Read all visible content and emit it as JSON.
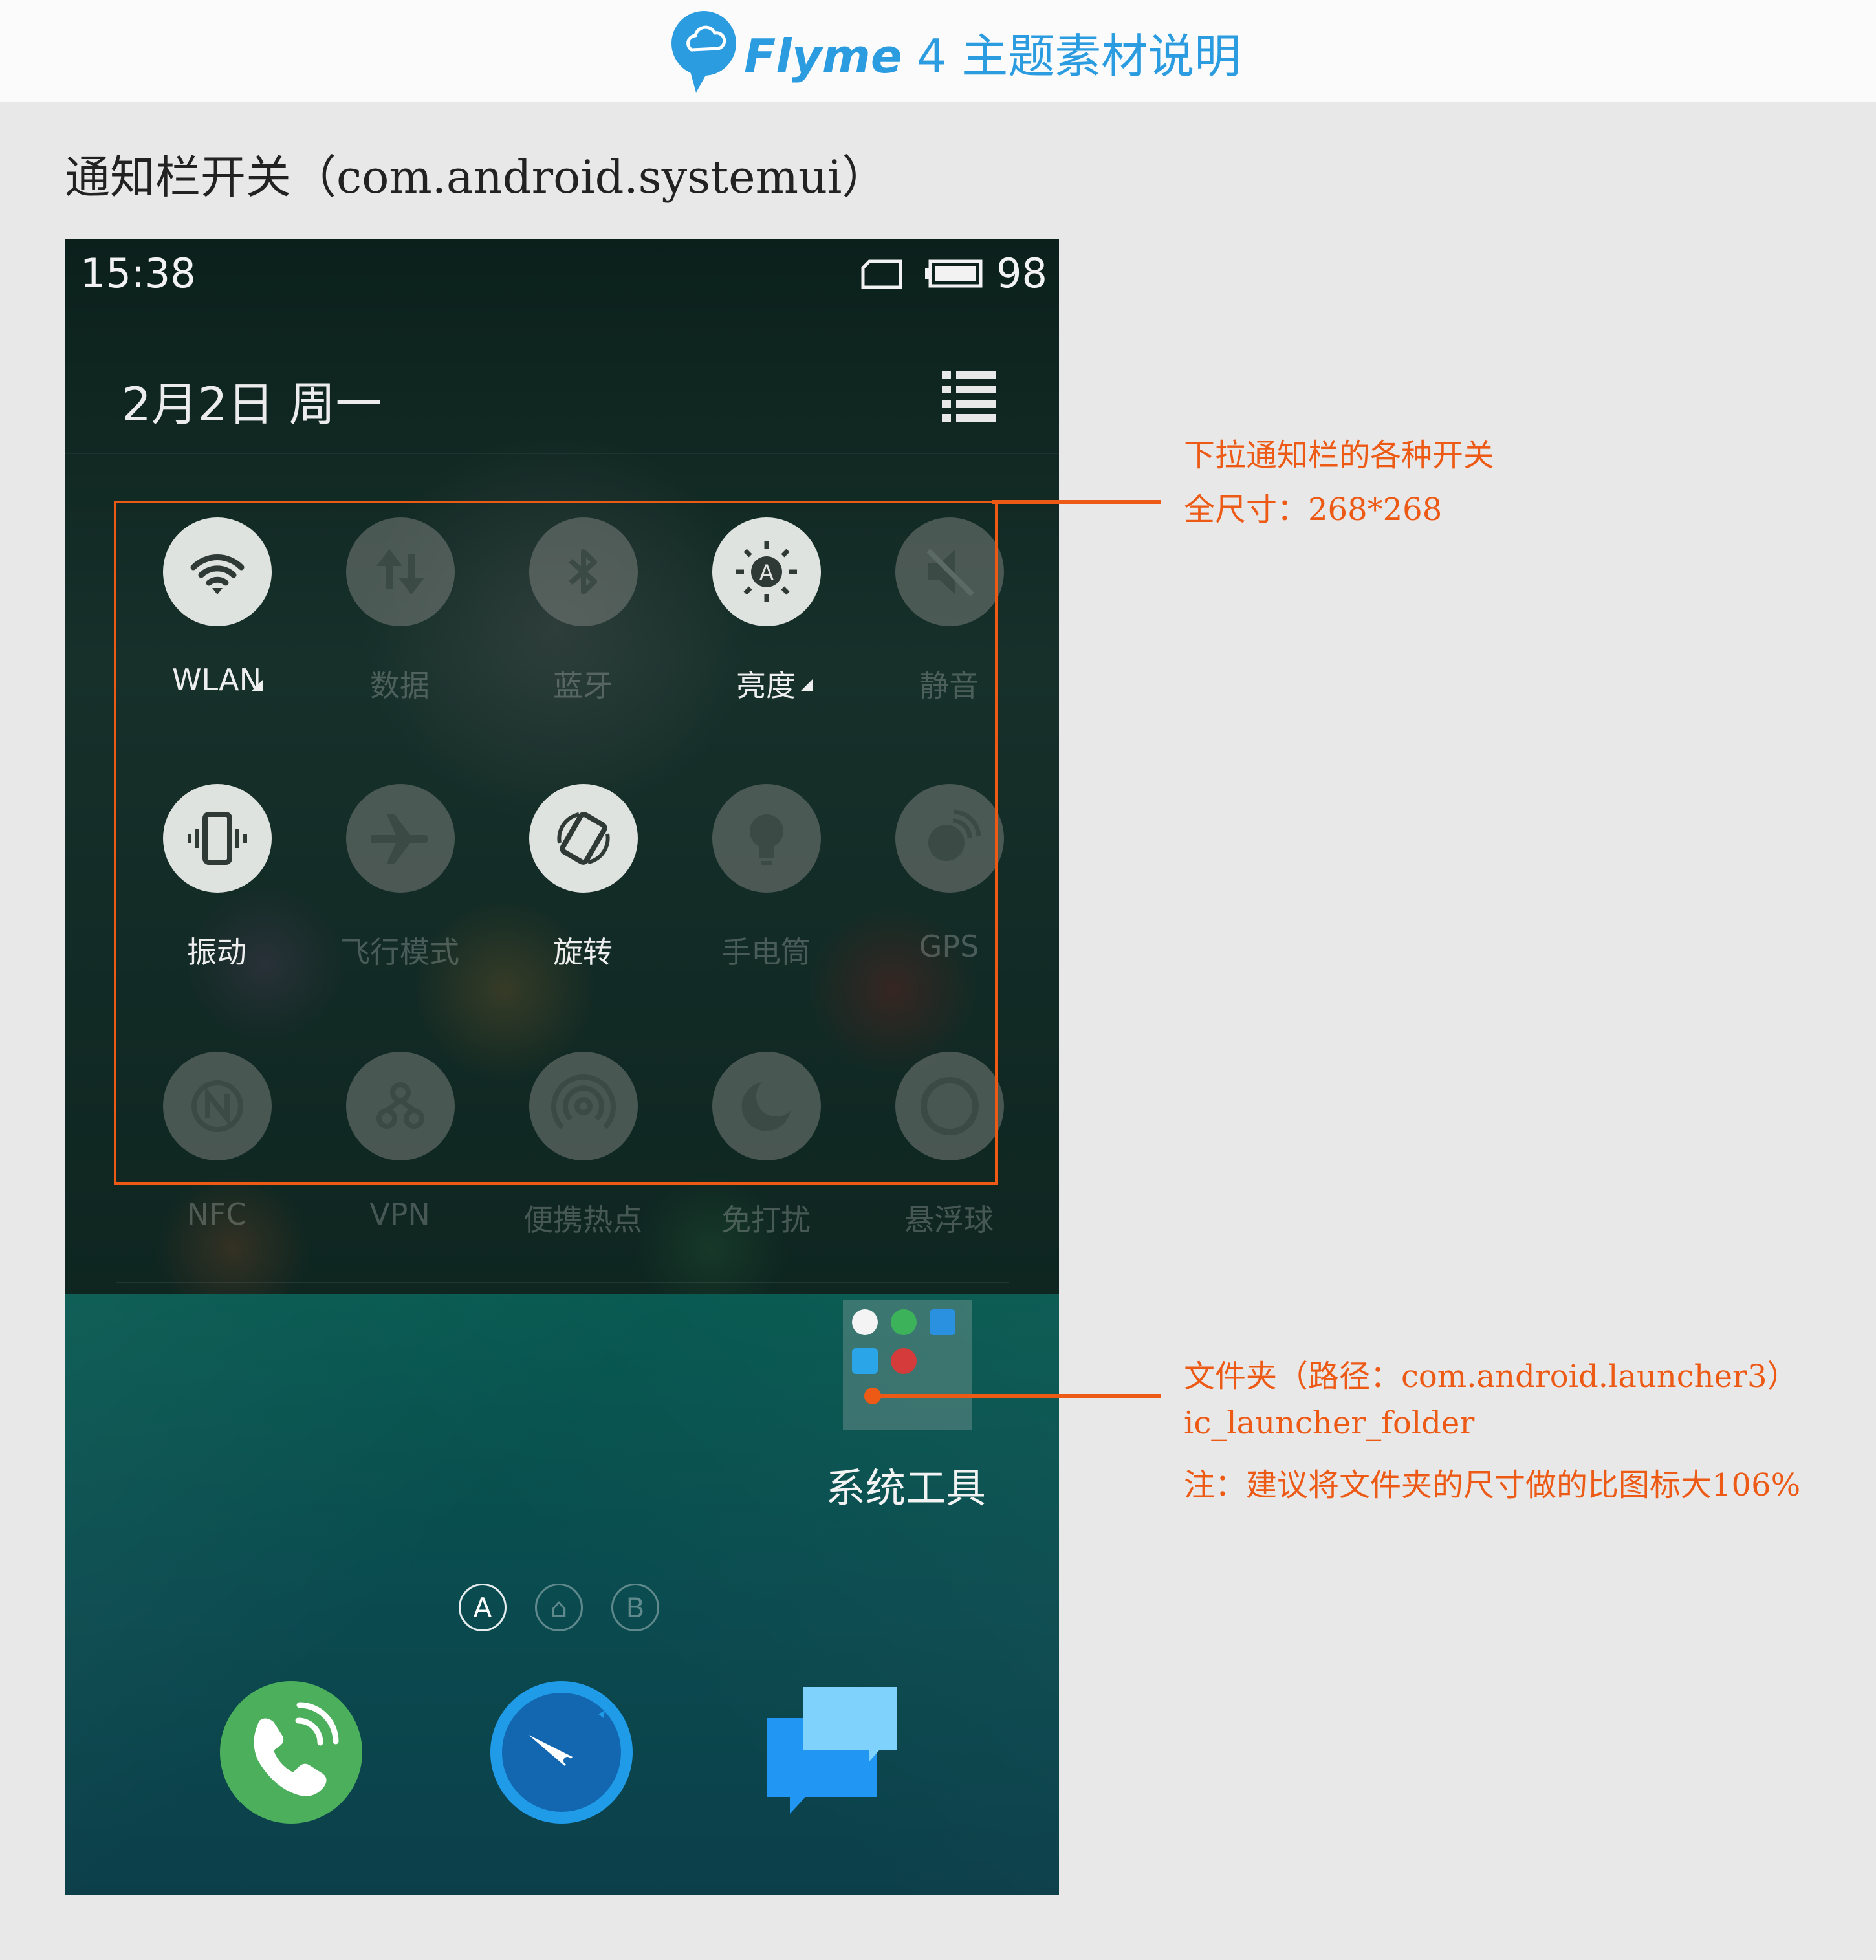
{
  "header": {
    "brand_flyme": "Flyme",
    "brand_rest": " 4 主题素材说明",
    "brand_color": "#2c9ce0"
  },
  "section_title": "通知栏开关（com.android.systemui）",
  "status_bar": {
    "time": "15:38",
    "battery": "98",
    "icons": [
      "sim-card-icon",
      "battery-icon"
    ]
  },
  "shade": {
    "date": "2月2日  周一",
    "menu_icon": "list-icon",
    "toggles": [
      {
        "label": "WLAN",
        "icon": "wifi-icon",
        "on": true,
        "expandable": true
      },
      {
        "label": "数据",
        "icon": "data-transfer-icon",
        "on": false,
        "expandable": false
      },
      {
        "label": "蓝牙",
        "icon": "bluetooth-icon",
        "on": false,
        "expandable": false
      },
      {
        "label": "亮度",
        "icon": "brightness-auto-icon",
        "on": true,
        "expandable": true
      },
      {
        "label": "静音",
        "icon": "mute-icon",
        "on": false,
        "expandable": false
      },
      {
        "label": "振动",
        "icon": "vibrate-icon",
        "on": true,
        "expandable": false
      },
      {
        "label": "飞行模式",
        "icon": "airplane-icon",
        "on": false,
        "expandable": false
      },
      {
        "label": "旋转",
        "icon": "rotate-icon",
        "on": true,
        "expandable": false
      },
      {
        "label": "手电筒",
        "icon": "flashlight-icon",
        "on": false,
        "expandable": false
      },
      {
        "label": "GPS",
        "icon": "gps-icon",
        "on": false,
        "expandable": false
      },
      {
        "label": "NFC",
        "icon": "nfc-icon",
        "on": false,
        "expandable": false
      },
      {
        "label": "VPN",
        "icon": "vpn-icon",
        "on": false,
        "expandable": false
      },
      {
        "label": "便携热点",
        "icon": "hotspot-icon",
        "on": false,
        "expandable": false
      },
      {
        "label": "免打扰",
        "icon": "moon-icon",
        "on": false,
        "expandable": false
      },
      {
        "label": "悬浮球",
        "icon": "floating-ball-icon",
        "on": false,
        "expandable": false
      }
    ]
  },
  "home": {
    "folder_label": "系统工具",
    "page_indicators": [
      "A",
      "⌂",
      "B"
    ],
    "dock": [
      "phone-icon",
      "compass-browser-icon",
      "messages-icon"
    ]
  },
  "annotations": {
    "toggles_title": "下拉通知栏的各种开关",
    "toggles_size": "全尺寸：268*268",
    "folder_path": "文件夹（路径：com.android.launcher3）",
    "folder_name": "ic_launcher_folder",
    "folder_note": "注：建议将文件夹的尺寸做的比图标大106%",
    "accent_color": "#ec5a16"
  }
}
